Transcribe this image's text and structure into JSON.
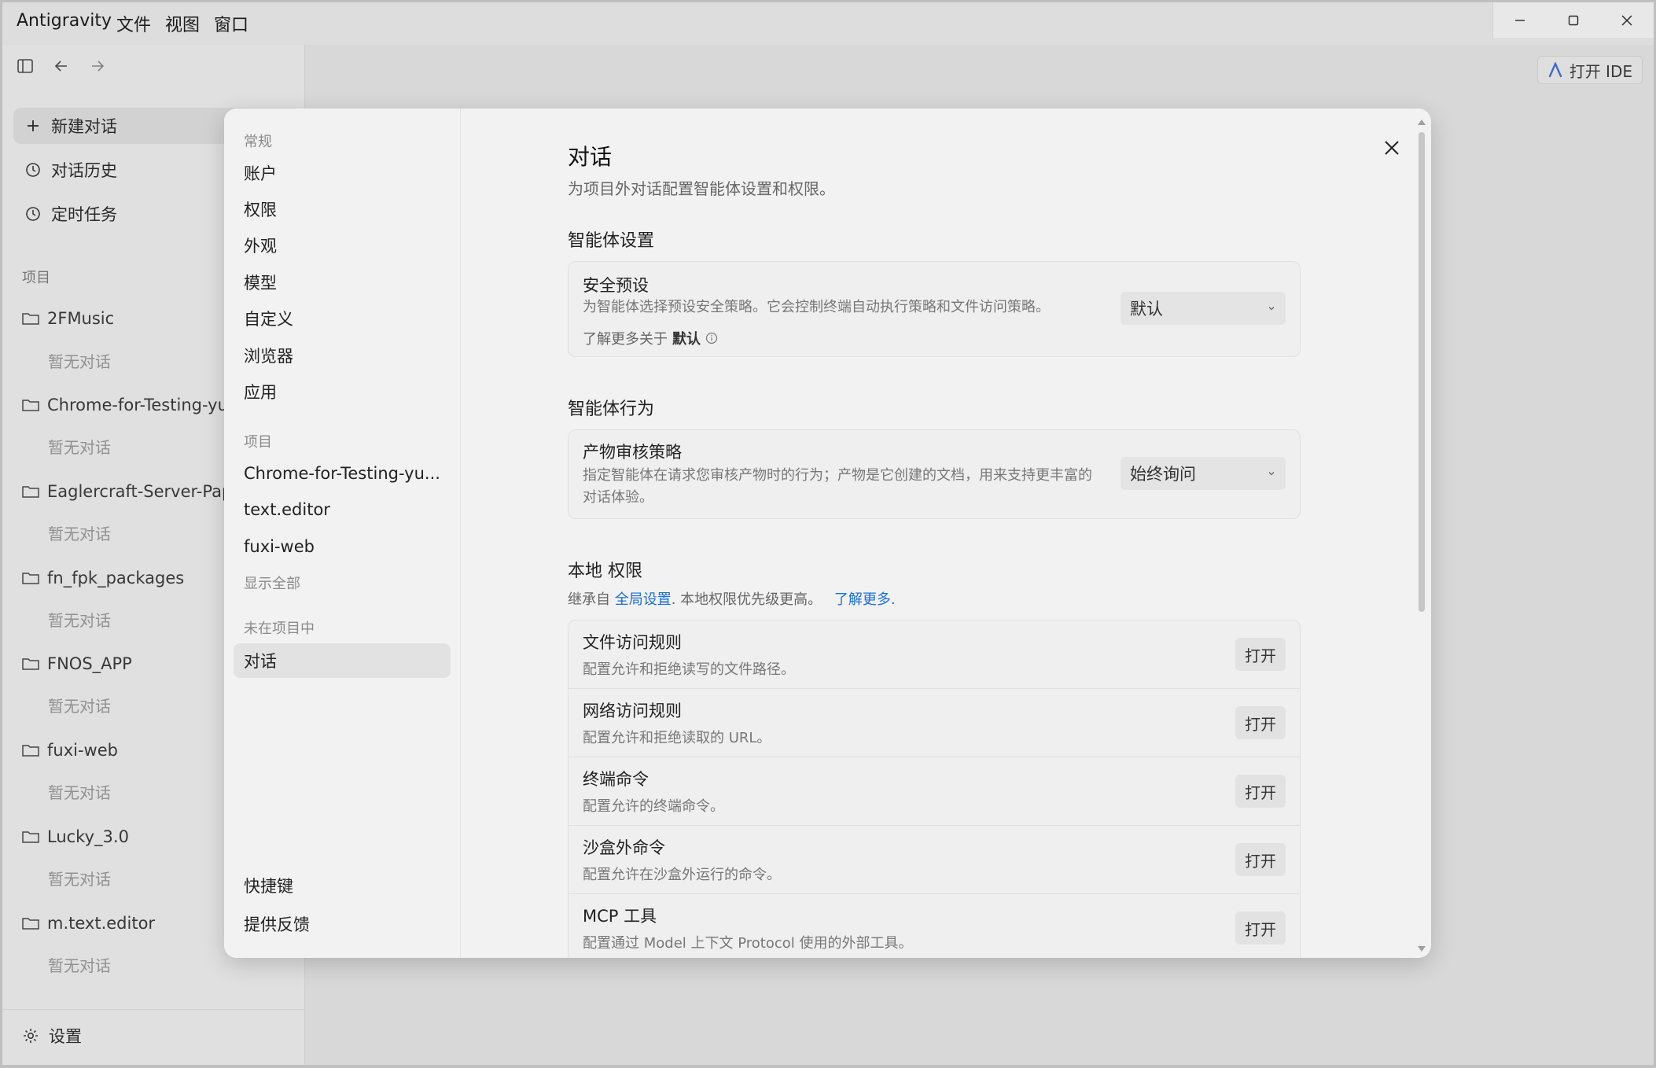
{
  "app": {
    "title": "Antigravity",
    "menu": [
      "文件",
      "视图",
      "窗口"
    ]
  },
  "sidebar": {
    "new_chat": "新建对话",
    "history": "对话历史",
    "scheduled": "定时任务",
    "projects_label": "项目",
    "projects": [
      {
        "name": "2FMusic",
        "empty": "暂无对话"
      },
      {
        "name": "Chrome-for-Testing-yu",
        "empty": "暂无对话"
      },
      {
        "name": "Eaglercraft-Server-Pap",
        "empty": "暂无对话"
      },
      {
        "name": "fn_fpk_packages",
        "empty": "暂无对话"
      },
      {
        "name": "FNOS_APP",
        "empty": "暂无对话"
      },
      {
        "name": "fuxi-web",
        "empty": "暂无对话"
      },
      {
        "name": "Lucky_3.0",
        "empty": "暂无对话"
      },
      {
        "name": "m.text.editor",
        "empty": "暂无对话"
      }
    ],
    "settings": "设置"
  },
  "header": {
    "open_ide": "打开 IDE"
  },
  "settings_nav": {
    "general_label": "常规",
    "general_items": [
      "账户",
      "权限",
      "外观",
      "模型",
      "自定义",
      "浏览器",
      "应用"
    ],
    "projects_label": "项目",
    "project_items": [
      "Chrome-for-Testing-yu...",
      "text.editor",
      "fuxi-web"
    ],
    "show_all": "显示全部",
    "not_in_project_label": "未在项目中",
    "active_item": "对话",
    "shortcuts": "快捷键",
    "feedback": "提供反馈"
  },
  "content": {
    "title": "对话",
    "subtitle": "为项目外对话配置智能体设置和权限。",
    "agent_settings": {
      "section": "智能体设置",
      "card_title": "安全预设",
      "card_desc": "为智能体选择预设安全策略。它会控制终端自动执行策略和文件访问策略。",
      "learn_prefix": "了解更多关于",
      "learn_bold": "默认",
      "select_value": "默认"
    },
    "agent_behavior": {
      "section": "智能体行为",
      "card_title": "产物审核策略",
      "card_desc": "指定智能体在请求您审核产物时的行为；产物是它创建的文档，用来支持更丰富的对话体验。",
      "select_value": "始终询问"
    },
    "local_permissions": {
      "section": "本地 权限",
      "inherit_prefix": "继承自",
      "inherit_link": "全局设置",
      "inherit_middle": ". 本地权限优先级更高。",
      "learn_more": "了解更多",
      "learn_suffix": ".",
      "rows": [
        {
          "title": "文件访问规则",
          "desc": "配置允许和拒绝读写的文件路径。",
          "button": "打开"
        },
        {
          "title": "网络访问规则",
          "desc": "配置允许和拒绝读取的 URL。",
          "button": "打开"
        },
        {
          "title": "终端命令",
          "desc": "配置允许的终端命令。",
          "button": "打开"
        },
        {
          "title": "沙盒外命令",
          "desc": "配置允许在沙盒外运行的命令。",
          "button": "打开"
        },
        {
          "title": "MCP 工具",
          "desc": "配置通过 Model 上下文 Protocol 使用的外部工具。",
          "button": "打开"
        }
      ]
    }
  }
}
